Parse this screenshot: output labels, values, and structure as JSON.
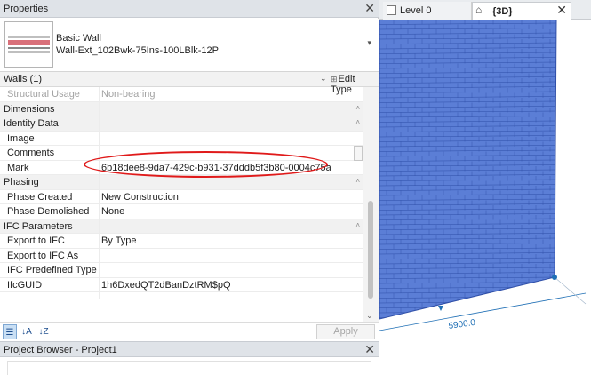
{
  "properties": {
    "title": "Properties",
    "type_family": "Basic Wall",
    "type_name": "Wall-Ext_102Bwk-75Ins-100LBlk-12P",
    "filter_label": "Walls (1)",
    "edit_type_label": "Edit Type",
    "rows": [
      {
        "kind": "param",
        "muted": true,
        "name": "Structural Usage",
        "value": "Non-bearing"
      },
      {
        "kind": "group",
        "name": "Dimensions"
      },
      {
        "kind": "group",
        "name": "Identity Data"
      },
      {
        "kind": "param",
        "name": "Image",
        "value": ""
      },
      {
        "kind": "param",
        "name": "Comments",
        "value": ""
      },
      {
        "kind": "param",
        "name": "Mark",
        "value": "6b18dee8-9da7-429c-b931-37dddb5f3b80-0004c75a"
      },
      {
        "kind": "group",
        "name": "Phasing"
      },
      {
        "kind": "param",
        "name": "Phase Created",
        "value": "New Construction"
      },
      {
        "kind": "param",
        "name": "Phase Demolished",
        "value": "None"
      },
      {
        "kind": "group",
        "name": "IFC Parameters"
      },
      {
        "kind": "param",
        "name": "Export to IFC",
        "value": "By Type"
      },
      {
        "kind": "param",
        "name": "Export to IFC As",
        "value": ""
      },
      {
        "kind": "param",
        "name": "IFC Predefined Type",
        "value": ""
      },
      {
        "kind": "param",
        "name": "IfcGUID",
        "value": "1h6DxedQT2dBanDztRM$pQ"
      }
    ],
    "apply_label": "Apply"
  },
  "project_browser": {
    "title": "Project Browser - Project1"
  },
  "views": {
    "tabs": [
      {
        "label": "Level 0",
        "active": false
      },
      {
        "label": "{3D}",
        "active": true
      }
    ],
    "dimension_label": "5900.0"
  },
  "colors": {
    "wall_fill": "#5b7ed6",
    "wall_lines": "#2f4fa8",
    "highlight": "#e01a1a",
    "dimension": "#1f6fb5"
  },
  "icons": [
    "close-icon",
    "dropdown-arrow-icon",
    "edit-type-icon",
    "categorize-icon",
    "sort-ascending-icon",
    "sort-descending-icon",
    "home-icon",
    "plan-view-icon"
  ]
}
